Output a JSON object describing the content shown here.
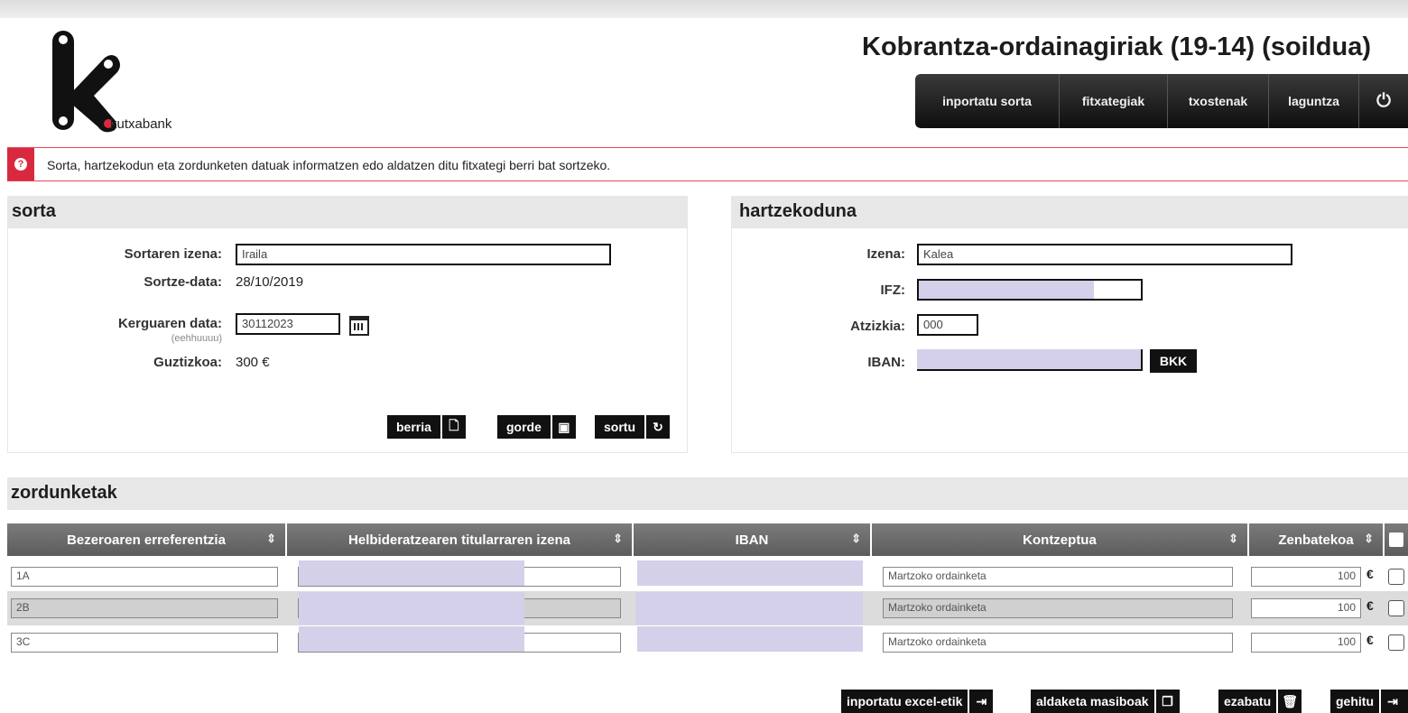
{
  "brand": {
    "logo_text": "kutxabank"
  },
  "page_title": "Kobrantza-ordainagiriak (19-14) (soildua)",
  "nav": {
    "items": [
      "inportatu sorta",
      "fitxategiak",
      "txostenak",
      "laguntza"
    ],
    "power_icon": "⏻"
  },
  "info": {
    "icon": "?",
    "message": "Sorta, hartzekodun eta zordunketen datuak informatzen edo aldatzen ditu fitxategi berri bat sortzeko."
  },
  "sorta": {
    "title": "sorta",
    "name_label": "Sortaren izena:",
    "name_value": "Iraila",
    "created_label": "Sortze-data:",
    "created_value": "28/10/2019",
    "charge_label": "Kerguaren data:",
    "charge_hint": "(eehhuuuu)",
    "charge_value": "30112023",
    "total_label": "Guztizkoa:",
    "total_value": "300 €",
    "buttons": {
      "new": "berria",
      "save": "gorde",
      "create": "sortu"
    }
  },
  "hartzekoduna": {
    "title": "hartzekoduna",
    "name_label": "Izena:",
    "name_value": "Kalea",
    "ifz_label": "IFZ:",
    "suffix_label": "Atzizkia:",
    "suffix_value": "000",
    "iban_label": "IBAN:",
    "bic_button": "BKK"
  },
  "zordunketak": {
    "title": "zordunketak",
    "columns": [
      "Bezeroaren erreferentzia",
      "Helbideratzearen titularraren izena",
      "IBAN",
      "Kontzeptua",
      "Zenbatekoa"
    ],
    "sort_icon": "⇕",
    "rows": [
      {
        "ref": "1A",
        "concept": "Martzoko ordainketa",
        "amount": "100",
        "currency": "€"
      },
      {
        "ref": "2B",
        "concept": "Martzoko ordainketa",
        "amount": "100",
        "currency": "€"
      },
      {
        "ref": "3C",
        "concept": "Martzoko ordainketa",
        "amount": "100",
        "currency": "€"
      }
    ]
  },
  "actions": {
    "import_excel": "inportatu excel-etik",
    "bulk_changes": "aldaketa masiboak",
    "delete": "ezabatu",
    "add": "gehitu"
  },
  "colors": {
    "accent_red": "#d9293e",
    "dark": "#111111",
    "masked": "#d4d0ea"
  }
}
